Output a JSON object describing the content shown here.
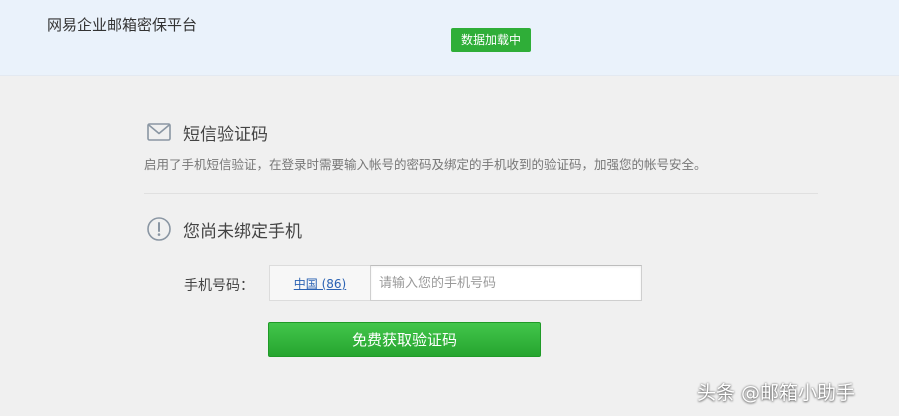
{
  "header": {
    "brand": "网易企业邮箱密保平台",
    "status_badge": "数据加载中"
  },
  "sms_section": {
    "icon": "envelope-icon",
    "title": "短信验证码",
    "description": "启用了手机短信验证，在登录时需要输入帐号的密码及绑定的手机收到的验证码，加强您的帐号安全。"
  },
  "bind_section": {
    "icon": "info-circle-icon",
    "title": "您尚未绑定手机"
  },
  "phone_form": {
    "label": "手机号码：",
    "country_code": "中国 (86)",
    "phone_value": "",
    "phone_placeholder": "请输入您的手机号码",
    "submit_label": "免费获取验证码"
  },
  "watermark": "头条 @邮箱小助手",
  "colors": {
    "header_bg": "#eaf2fb",
    "page_bg": "#f0f0f0",
    "accent_green": "#2fae38",
    "link_blue": "#2b62b3"
  }
}
